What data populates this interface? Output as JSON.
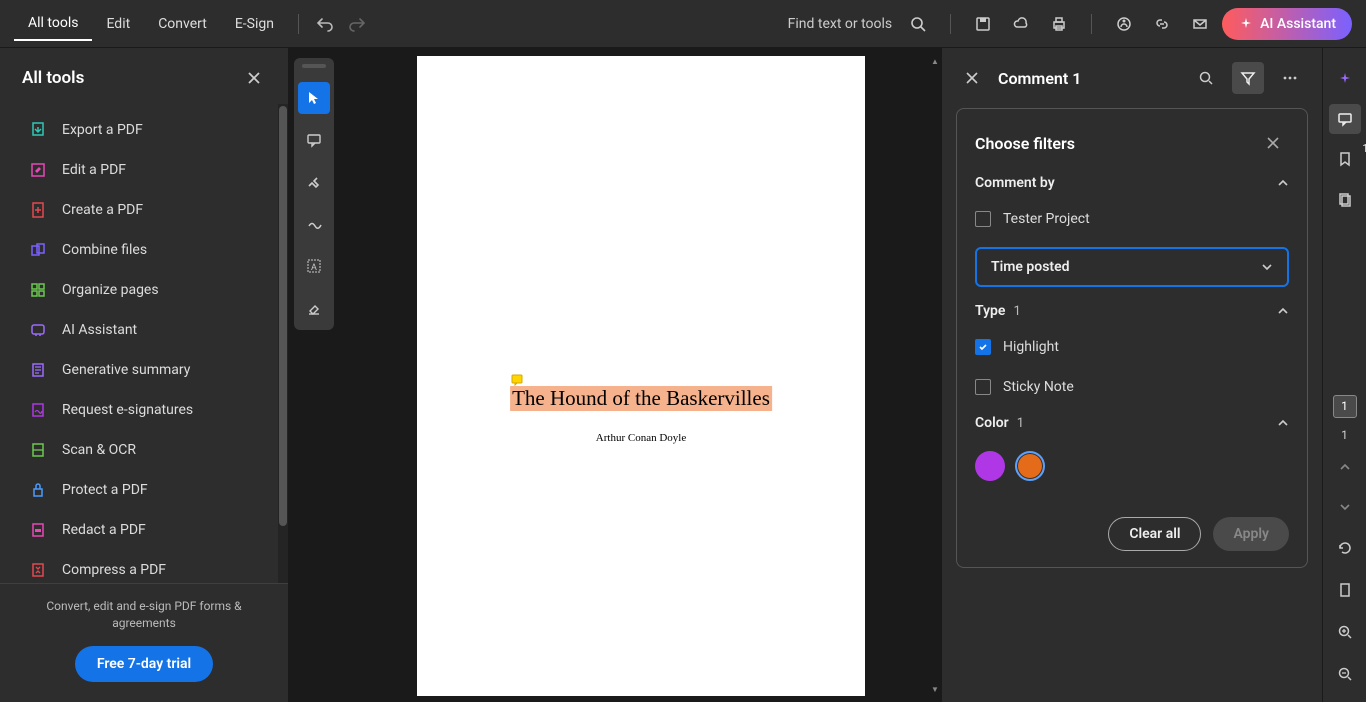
{
  "menu": {
    "all_tools": "All tools",
    "edit": "Edit",
    "convert": "Convert",
    "esign": "E-Sign"
  },
  "top": {
    "find": "Find text or tools",
    "ai": "AI Assistant"
  },
  "sidebar": {
    "title": "All tools",
    "tools": [
      "Export a PDF",
      "Edit a PDF",
      "Create a PDF",
      "Combine files",
      "Organize pages",
      "AI Assistant",
      "Generative summary",
      "Request e-signatures",
      "Scan & OCR",
      "Protect a PDF",
      "Redact a PDF",
      "Compress a PDF"
    ],
    "footer_text": "Convert, edit and e-sign PDF forms & agreements",
    "trial": "Free 7-day trial"
  },
  "document": {
    "title": "The Hound of the Baskervilles",
    "author": "Arthur Conan Doyle"
  },
  "comments": {
    "header": "Comment 1",
    "filters_title": "Choose filters",
    "comment_by": "Comment by",
    "author1": "Tester Project",
    "time_posted": "Time posted",
    "type": "Type",
    "type_count": "1",
    "highlight": "Highlight",
    "sticky": "Sticky Note",
    "color": "Color",
    "color_count": "1",
    "clear": "Clear all",
    "apply": "Apply"
  },
  "rail": {
    "comment_count": "1",
    "page": "1",
    "page_below": "1"
  }
}
